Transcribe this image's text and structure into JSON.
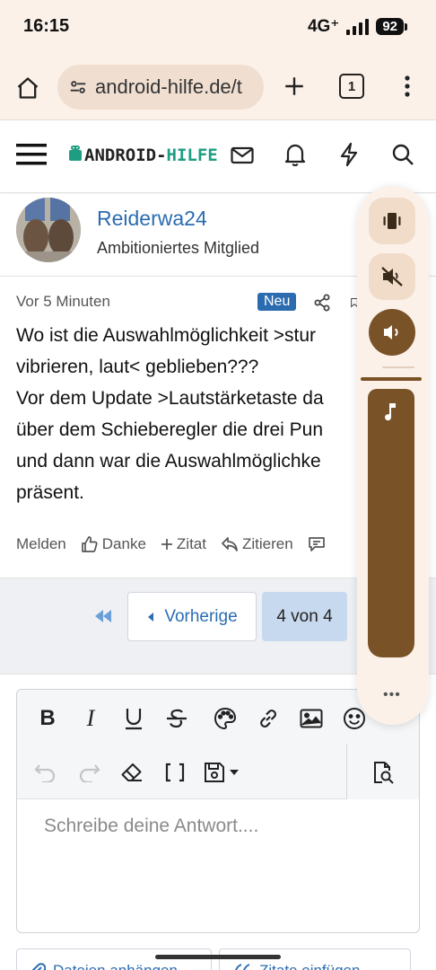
{
  "status_bar": {
    "time": "16:15",
    "network": "4G⁺",
    "battery": "92"
  },
  "browser": {
    "url": "android-hilfe.de/t",
    "tab_count": "1"
  },
  "site": {
    "logo_part1": "ANDROID-",
    "logo_part2": "HILFE"
  },
  "author": {
    "name": "Reiderwa24",
    "role": "Ambitioniertes Mitglied"
  },
  "post": {
    "time": "Vor 5 Minuten",
    "badge": "Neu",
    "lines": [
      "Wo ist die Auswahlmöglichkeit >stur",
      "vibrieren, laut< geblieben???",
      "Vor dem Update >Lautstärketaste da",
      "über dem Schieberegler die drei Pun",
      "und dann war die Auswahlmöglichke",
      "präsent."
    ],
    "actions": {
      "report": "Melden",
      "thanks": "Danke",
      "quote": "Zitat",
      "reply_quote": "Zitieren"
    }
  },
  "pagination": {
    "prev_label": "Vorherige",
    "current": "4 von 4"
  },
  "editor": {
    "placeholder": "Schreibe deine Antwort...."
  },
  "bottom_buttons": {
    "attach": "Dateien anhängen",
    "insert_quote": "Zitate einfügen"
  },
  "volume_panel": {
    "mode": "sound",
    "media_level": 1.0
  },
  "colors": {
    "accent": "#2b6cb0",
    "brand_green": "#1f9d83",
    "volume_brown": "#7a5227",
    "chrome_bg": "#fbf1e9"
  }
}
